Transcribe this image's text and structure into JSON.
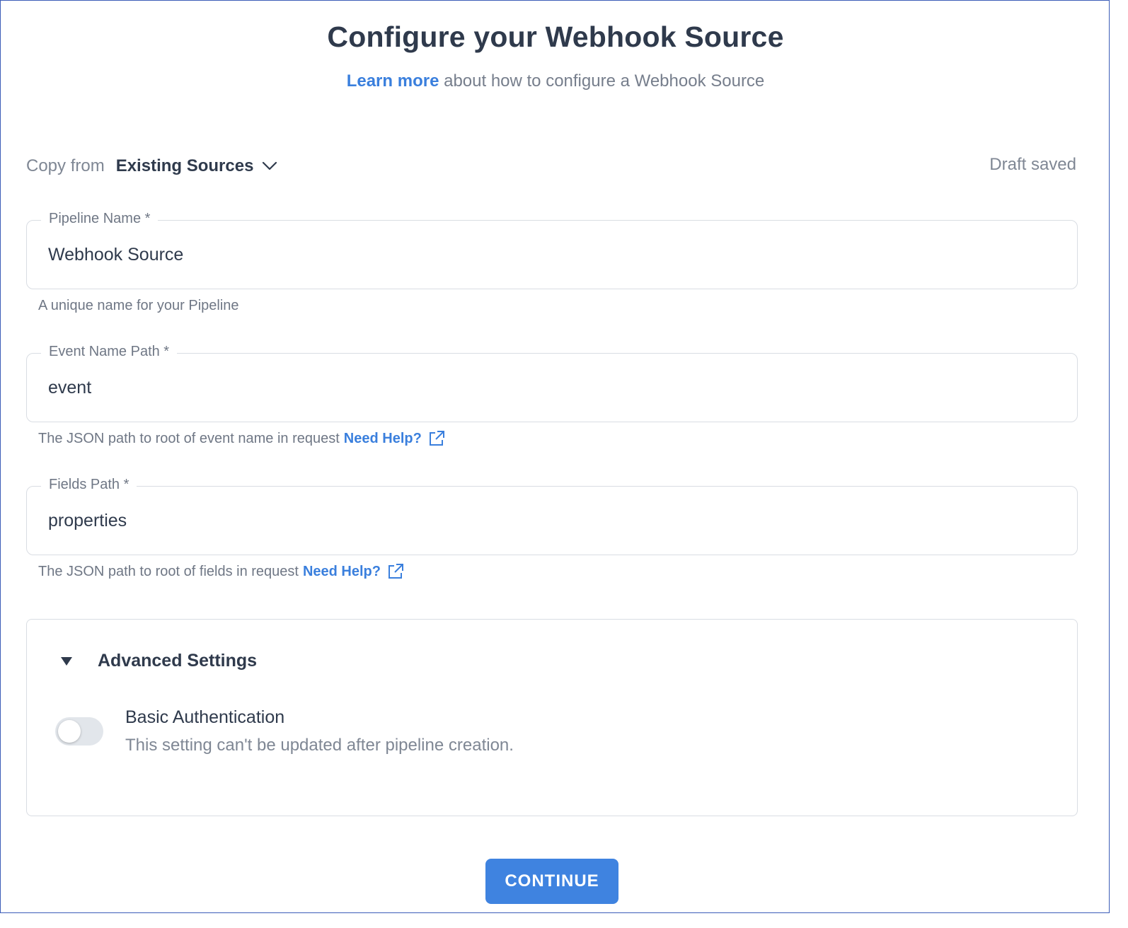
{
  "header": {
    "title": "Configure your Webhook Source",
    "learn_more": "Learn more",
    "subtitle_rest": " about how to configure a Webhook Source"
  },
  "copy_from": {
    "label": "Copy from",
    "selected": "Existing Sources"
  },
  "status": {
    "draft": "Draft saved"
  },
  "fields": {
    "pipeline_name": {
      "label": "Pipeline Name *",
      "value": "Webhook Source",
      "helper": "A unique name for your Pipeline"
    },
    "event_name_path": {
      "label": "Event Name Path *",
      "value": "event",
      "helper": "The JSON path to root of event name in request",
      "help_link": "Need Help?"
    },
    "fields_path": {
      "label": "Fields Path *",
      "value": "properties",
      "helper": "The JSON path to root of fields in request",
      "help_link": "Need Help?"
    }
  },
  "advanced": {
    "title": "Advanced Settings",
    "basic_auth": {
      "title": "Basic Authentication",
      "description": "This setting can't be updated after pipeline creation.",
      "enabled": false
    }
  },
  "footer": {
    "continue_label": "CONTINUE"
  },
  "colors": {
    "accent": "#3f83e0",
    "link": "#3a7fdd",
    "text": "#2f3a4c",
    "muted": "#7f8794",
    "border": "#d9dde3"
  },
  "icons": {
    "dropdown": "chevron-down-icon",
    "help": "external-link-icon",
    "collapse": "triangle-down-icon"
  }
}
